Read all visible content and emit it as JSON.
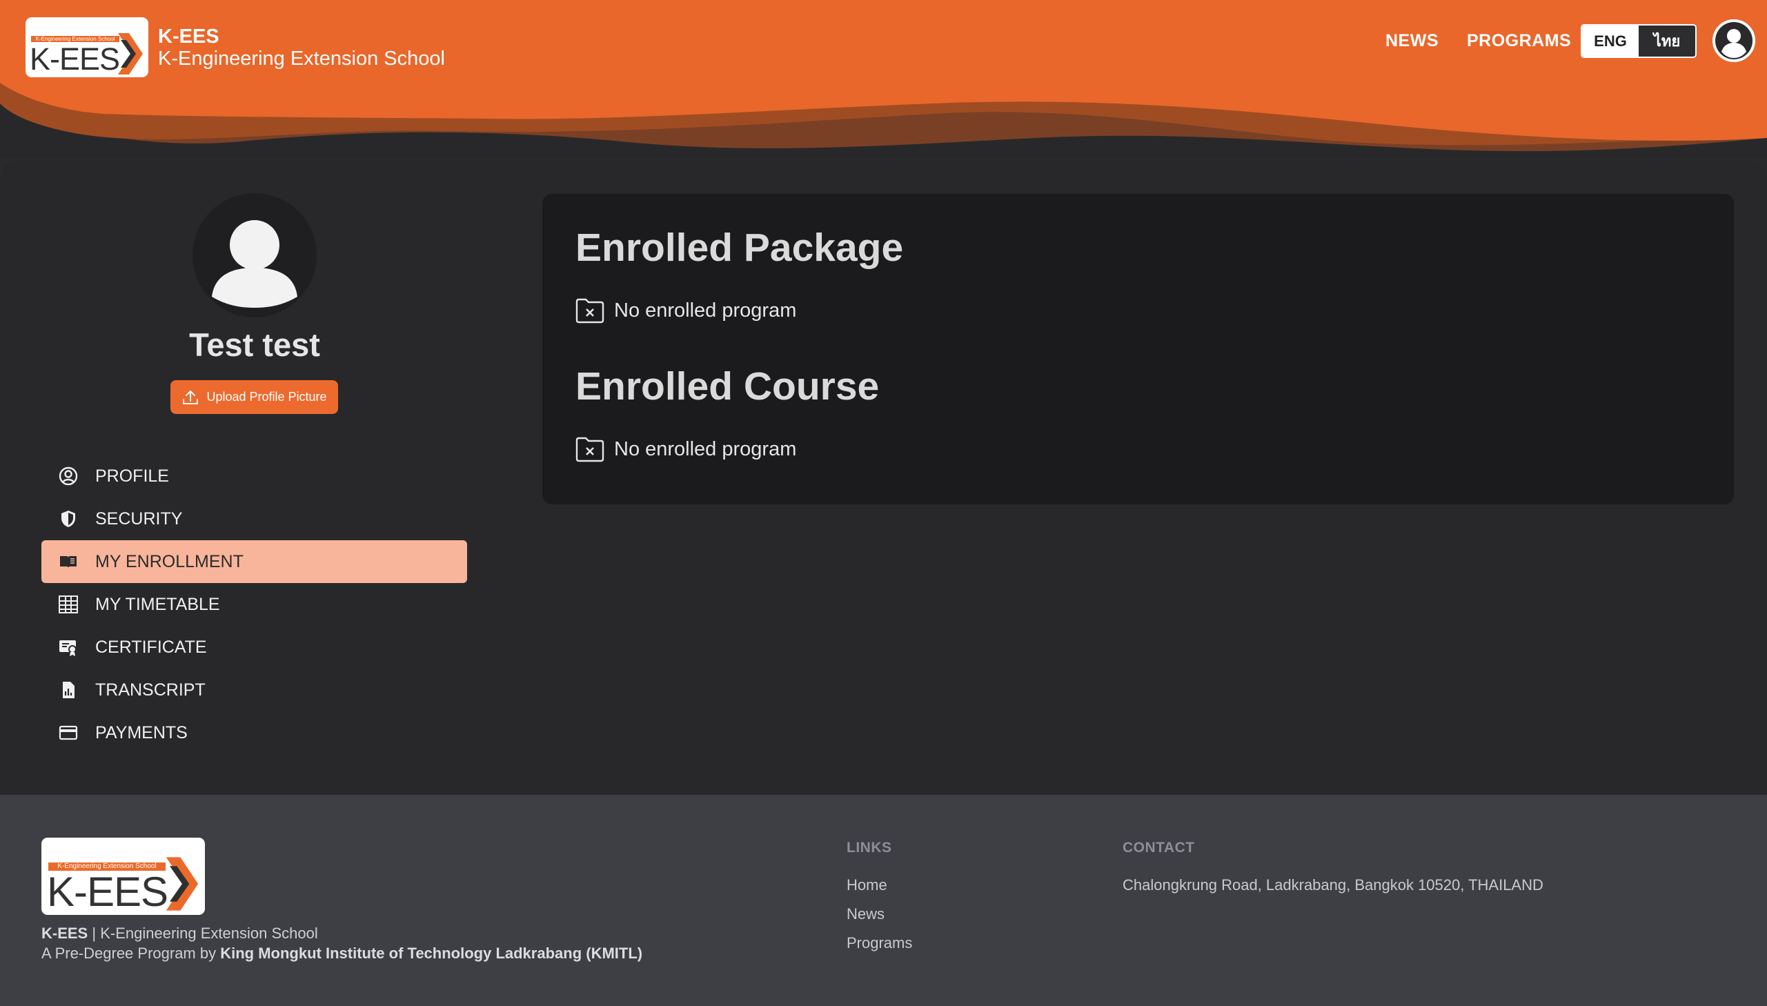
{
  "header": {
    "logo_tag": "K-Engineering Extension School",
    "logo_word": "K-EES",
    "brand_name": "K-EES",
    "brand_subtitle": "K-Engineering Extension School",
    "nav": {
      "news": "NEWS",
      "programs": "PROGRAMS"
    },
    "lang": {
      "eng": "ENG",
      "thai": "ไทย",
      "active": "ENG"
    },
    "user_icon": "user-icon"
  },
  "profile": {
    "name": "Test test",
    "upload_label": "Upload Profile Picture"
  },
  "sidebar": {
    "items": [
      {
        "label": "PROFILE",
        "icon": "user-circle-icon",
        "active": false
      },
      {
        "label": "SECURITY",
        "icon": "shield-icon",
        "active": false
      },
      {
        "label": "MY ENROLLMENT",
        "icon": "book-icon",
        "active": true
      },
      {
        "label": "MY TIMETABLE",
        "icon": "table-icon",
        "active": false
      },
      {
        "label": "CERTIFICATE",
        "icon": "certificate-icon",
        "active": false
      },
      {
        "label": "TRANSCRIPT",
        "icon": "transcript-icon",
        "active": false
      },
      {
        "label": "PAYMENTS",
        "icon": "credit-card-icon",
        "active": false
      }
    ]
  },
  "content": {
    "package_title": "Enrolled Package",
    "package_empty": "No enrolled program",
    "course_title": "Enrolled Course",
    "course_empty": "No enrolled program"
  },
  "footer": {
    "logo_tag": "K-Engineering Extension School",
    "logo_word": "K-EES",
    "brand_short": "K-EES",
    "brand_sep": " | ",
    "brand_full": "K-Engineering Extension School",
    "tagline_prefix": "A Pre-Degree Program by ",
    "tagline_org": "King Mongkut Institute of Technology Ladkrabang (KMITL)",
    "links_heading": "LINKS",
    "links": [
      "Home",
      "News",
      "Programs"
    ],
    "contact_heading": "CONTACT",
    "contact_address": "Chalongkrung Road, Ladkrabang, Bangkok 10520, THAILAND"
  },
  "colors": {
    "accent": "#ec6a2e",
    "active_bg": "#f8b59b",
    "page_bg": "#28282b",
    "card_bg": "#1b1b1d",
    "footer_bg": "#3e3f45"
  }
}
